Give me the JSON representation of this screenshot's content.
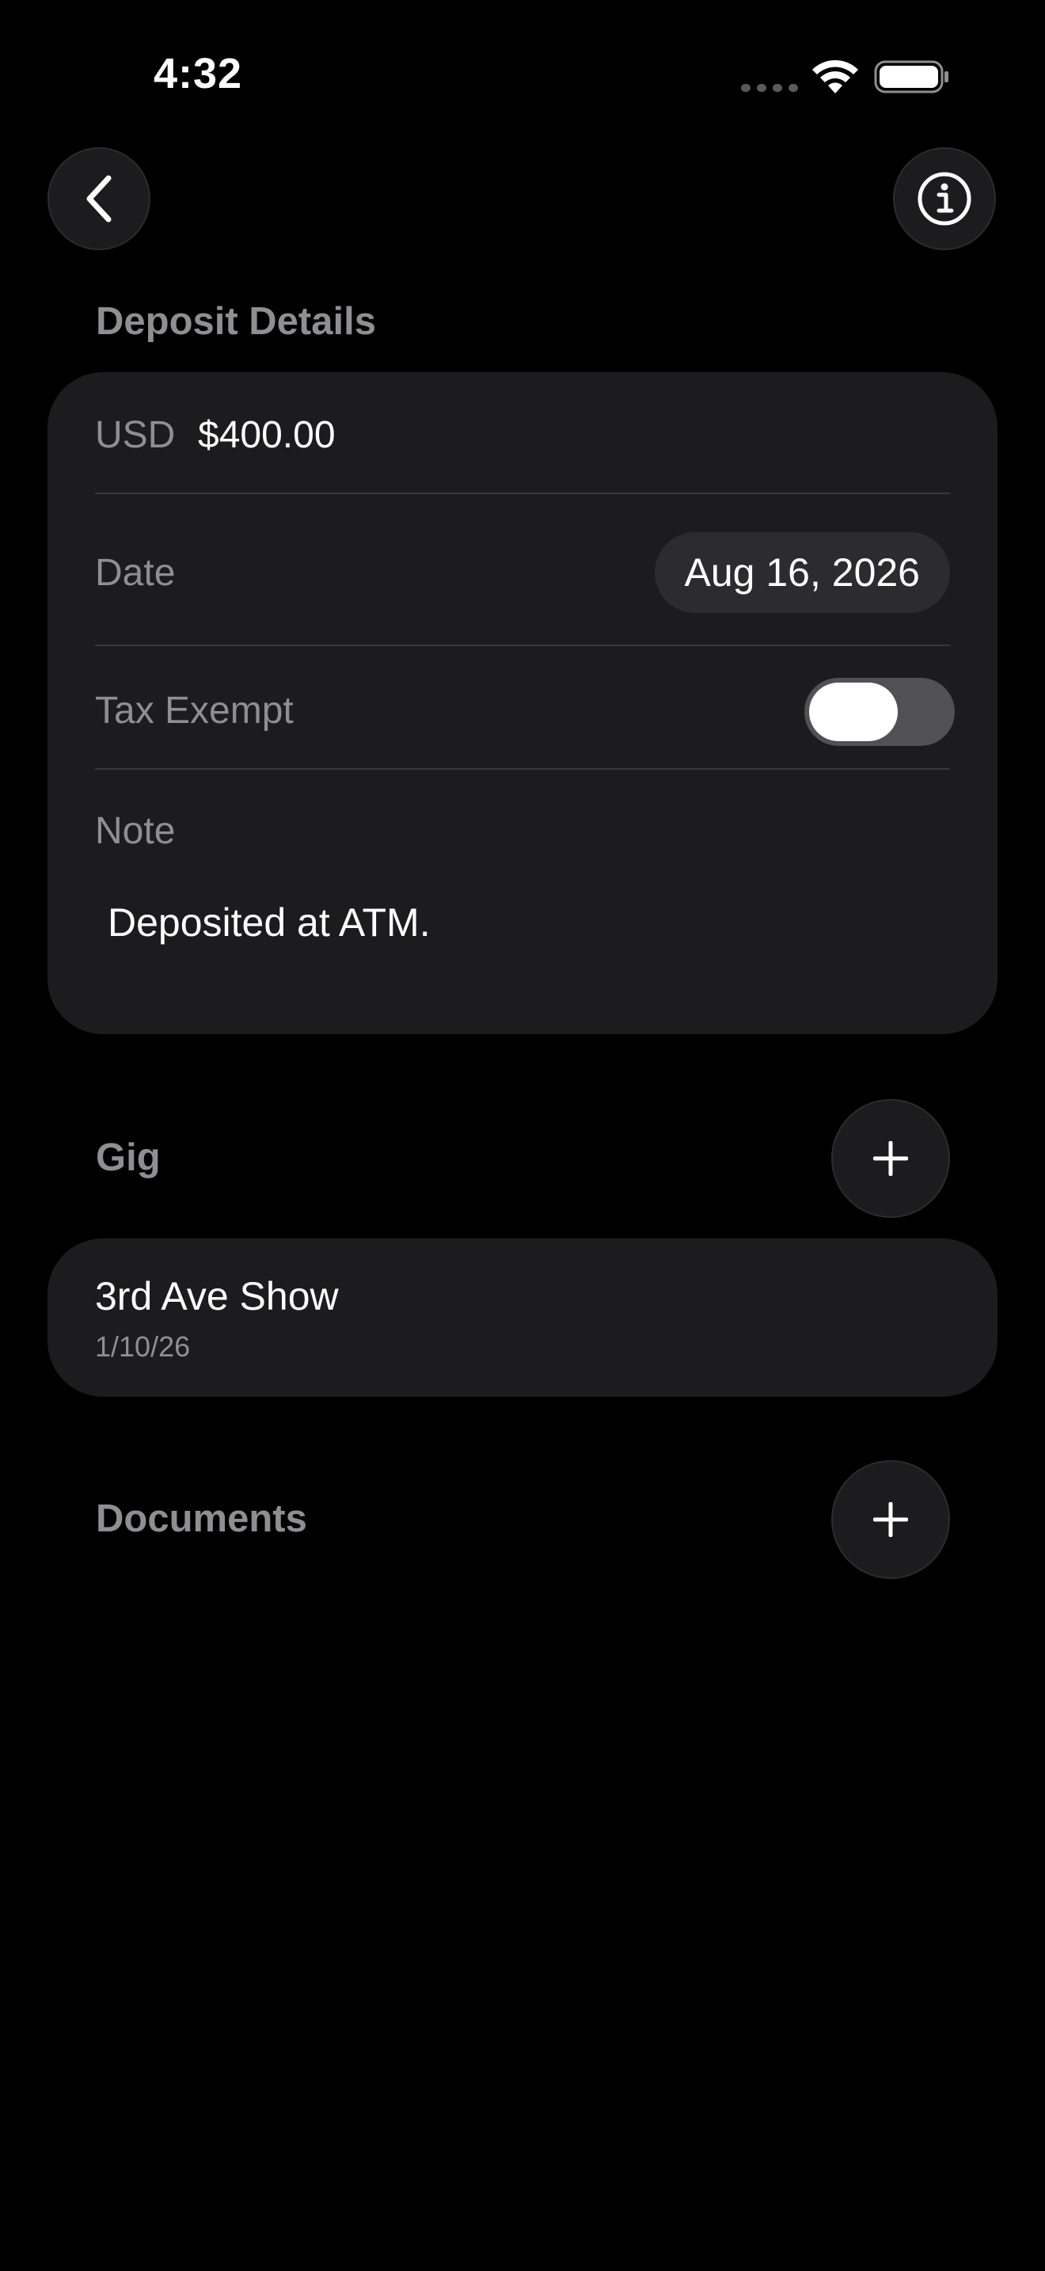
{
  "status_bar": {
    "time": "4:32"
  },
  "nav": {
    "back_icon": "chevron-left-icon",
    "info_icon": "info-circle-icon"
  },
  "deposit": {
    "section_title": "Deposit Details",
    "currency": "USD",
    "amount": "$400.00",
    "date_label": "Date",
    "date_value": "Aug 16, 2026",
    "tax_exempt_label": "Tax Exempt",
    "tax_exempt_on": false,
    "note_label": "Note",
    "note_value": "Deposited at ATM."
  },
  "gig": {
    "section_title": "Gig",
    "add_icon": "plus-icon",
    "items": [
      {
        "title": "3rd Ave Show",
        "date": "1/10/26"
      }
    ]
  },
  "documents": {
    "section_title": "Documents",
    "add_icon": "plus-icon"
  },
  "colors": {
    "background": "#000000",
    "card": "#1c1c1e",
    "secondary_text": "#8e8e93",
    "toggle_track": "#515155"
  }
}
